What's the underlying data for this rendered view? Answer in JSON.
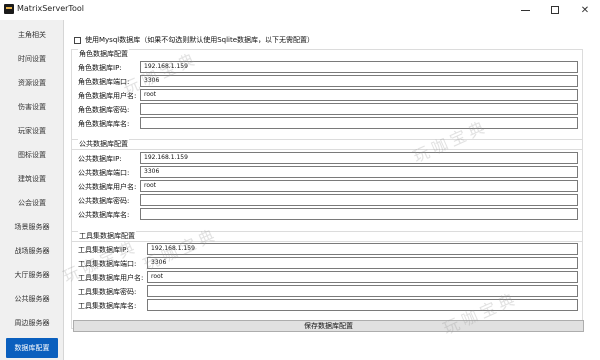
{
  "window": {
    "title": "MatrixServerTool",
    "minimize_glyph": "",
    "maximize_glyph": "",
    "close_glyph": "✕"
  },
  "sidebar": {
    "items": [
      {
        "label": "主角相关",
        "active": false
      },
      {
        "label": "时间设置",
        "active": false
      },
      {
        "label": "资源设置",
        "active": false
      },
      {
        "label": "伤害设置",
        "active": false
      },
      {
        "label": "玩家设置",
        "active": false
      },
      {
        "label": "图标设置",
        "active": false
      },
      {
        "label": "建筑设置",
        "active": false
      },
      {
        "label": "公会设置",
        "active": false
      },
      {
        "label": "场景服务器",
        "active": false
      },
      {
        "label": "战场服务器",
        "active": false
      },
      {
        "label": "大厅服务器",
        "active": false
      },
      {
        "label": "公共服务器",
        "active": false
      },
      {
        "label": "周边服务器",
        "active": false
      },
      {
        "label": "数据库配置",
        "active": true
      }
    ]
  },
  "mysql_checkbox": {
    "label": "使用Mysql数据库（如果不勾选则默认使用Sqlite数据库，以下无需配置）",
    "checked": false
  },
  "groups": [
    {
      "title": "角色数据库配置",
      "rows": [
        {
          "label": "角色数据库IP:",
          "value": "192.168.1.159"
        },
        {
          "label": "角色数据库端口:",
          "value": "3306"
        },
        {
          "label": "角色数据库用户名:",
          "value": "root"
        },
        {
          "label": "角色数据库密码:",
          "value": ""
        },
        {
          "label": "角色数据库库名:",
          "value": ""
        }
      ]
    },
    {
      "title": "公共数据库配置",
      "rows": [
        {
          "label": "公共数据库IP:",
          "value": "192.168.1.159"
        },
        {
          "label": "公共数据库端口:",
          "value": "3306"
        },
        {
          "label": "公共数据库用户名:",
          "value": "root"
        },
        {
          "label": "公共数据库密码:",
          "value": ""
        },
        {
          "label": "公共数据库库名:",
          "value": ""
        }
      ]
    },
    {
      "title": "工具集数据库配置",
      "rows": [
        {
          "label": "工具集数据库IP:",
          "value": "192.168.1.159"
        },
        {
          "label": "工具集数据库端口:",
          "value": "3306"
        },
        {
          "label": "工具集数据库用户名:",
          "value": "root"
        },
        {
          "label": "工具集数据库密码:",
          "value": ""
        },
        {
          "label": "工具集数据库库名:",
          "value": ""
        }
      ]
    }
  ],
  "save_button": {
    "label": "保存数据库配置"
  },
  "watermark": {
    "text": "玩咖宝典"
  },
  "colors": {
    "accent": "#0a5fbe",
    "sidebar_bg": "#f0f0f0"
  }
}
